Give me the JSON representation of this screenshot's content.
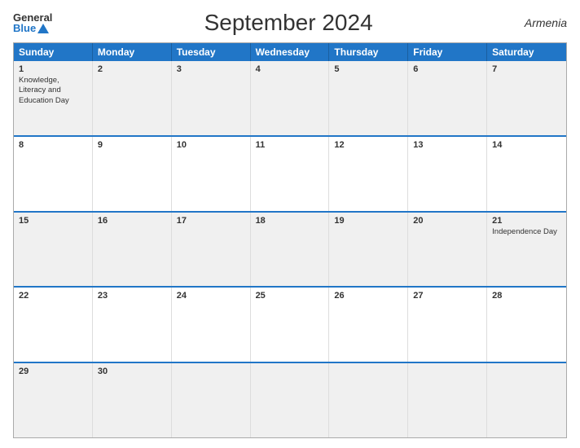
{
  "header": {
    "logo_general": "General",
    "logo_blue": "Blue",
    "title": "September 2024",
    "country": "Armenia"
  },
  "dayHeaders": [
    "Sunday",
    "Monday",
    "Tuesday",
    "Wednesday",
    "Thursday",
    "Friday",
    "Saturday"
  ],
  "weeks": [
    [
      {
        "num": "1",
        "event": "Knowledge, Literacy and Education Day"
      },
      {
        "num": "2",
        "event": ""
      },
      {
        "num": "3",
        "event": ""
      },
      {
        "num": "4",
        "event": ""
      },
      {
        "num": "5",
        "event": ""
      },
      {
        "num": "6",
        "event": ""
      },
      {
        "num": "7",
        "event": ""
      }
    ],
    [
      {
        "num": "8",
        "event": ""
      },
      {
        "num": "9",
        "event": ""
      },
      {
        "num": "10",
        "event": ""
      },
      {
        "num": "11",
        "event": ""
      },
      {
        "num": "12",
        "event": ""
      },
      {
        "num": "13",
        "event": ""
      },
      {
        "num": "14",
        "event": ""
      }
    ],
    [
      {
        "num": "15",
        "event": ""
      },
      {
        "num": "16",
        "event": ""
      },
      {
        "num": "17",
        "event": ""
      },
      {
        "num": "18",
        "event": ""
      },
      {
        "num": "19",
        "event": ""
      },
      {
        "num": "20",
        "event": ""
      },
      {
        "num": "21",
        "event": "Independence Day"
      }
    ],
    [
      {
        "num": "22",
        "event": ""
      },
      {
        "num": "23",
        "event": ""
      },
      {
        "num": "24",
        "event": ""
      },
      {
        "num": "25",
        "event": ""
      },
      {
        "num": "26",
        "event": ""
      },
      {
        "num": "27",
        "event": ""
      },
      {
        "num": "28",
        "event": ""
      }
    ],
    [
      {
        "num": "29",
        "event": ""
      },
      {
        "num": "30",
        "event": ""
      },
      {
        "num": "",
        "event": ""
      },
      {
        "num": "",
        "event": ""
      },
      {
        "num": "",
        "event": ""
      },
      {
        "num": "",
        "event": ""
      },
      {
        "num": "",
        "event": ""
      }
    ]
  ]
}
